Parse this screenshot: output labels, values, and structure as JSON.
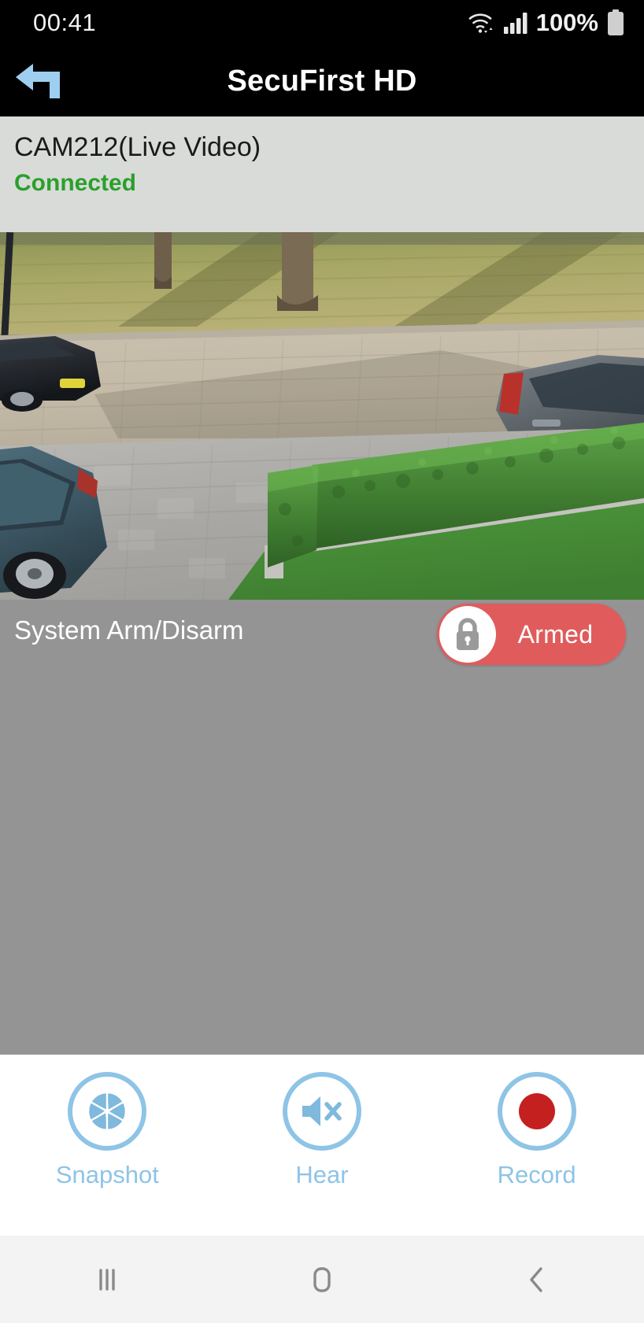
{
  "status_bar": {
    "clock": "00:41",
    "battery_percent": "100%",
    "wifi_icon": "wifi-signal-icon",
    "signal_icon": "cellular-signal-icon",
    "battery_icon": "battery-full-icon"
  },
  "title_bar": {
    "title": "SecuFirst HD",
    "back_icon": "back-arrow-icon",
    "back_color": "#9ecff0"
  },
  "camera_info": {
    "name": "CAM212(Live Video)",
    "status": "Connected",
    "status_color": "#2aa02a",
    "panel_color": "#d9dbd9"
  },
  "video": {
    "alt": "live-camera-street-view"
  },
  "arm_panel": {
    "label": "System Arm/Disarm",
    "toggle_state": "Armed",
    "toggle_color": "#e05c5c",
    "lock_icon": "padlock-icon",
    "panel_color": "#949494"
  },
  "controls": {
    "accent_color": "#8ec4e6",
    "items": [
      {
        "label": "Snapshot",
        "icon": "camera-aperture-icon"
      },
      {
        "label": "Hear",
        "icon": "speaker-muted-icon"
      },
      {
        "label": "Record",
        "icon": "record-dot-icon"
      }
    ]
  },
  "nav_bar": {
    "recents_icon": "recents-icon",
    "home_icon": "home-icon",
    "back_icon": "back-chevron-icon"
  }
}
